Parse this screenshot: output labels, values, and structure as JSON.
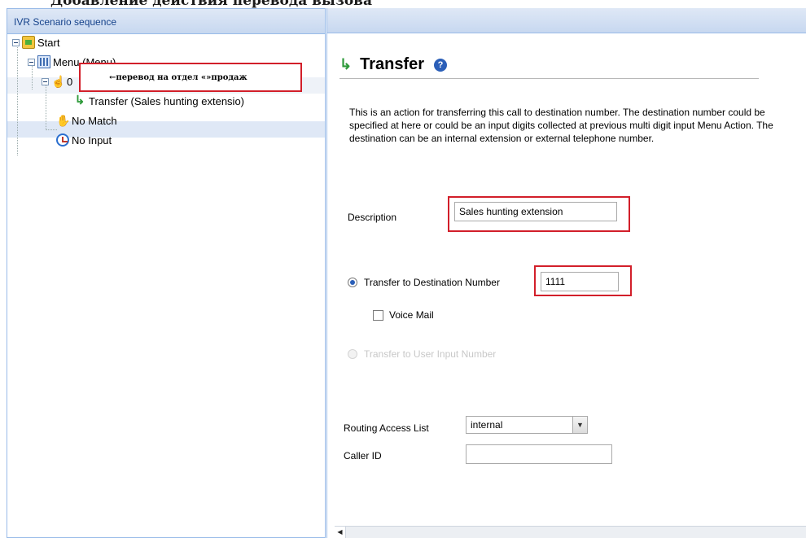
{
  "page_heading": "Добавление действия перевода вызова",
  "left_panel": {
    "title": "IVR Scenario sequence",
    "tree": {
      "start": "Start",
      "menu": "Menu (Menu)",
      "key": "0",
      "annotation": "←перевод на отдел «»продаж",
      "transfer": "Transfer (Sales hunting extensio)",
      "no_match": "No Match",
      "no_input": "No Input"
    }
  },
  "detail": {
    "title": "Transfer",
    "description": "This is an action for transferring this call to destination number. The destination number could be specified at here or could be an input digits collected at previous multi digit input Menu Action. The destination can be an internal extension or external telephone number.",
    "description_label": "Description",
    "description_value": "Sales hunting extension",
    "transfer_dest_label": "Transfer to Destination Number",
    "transfer_dest_value": "1111",
    "voice_mail_label": "Voice Mail",
    "transfer_user_label": "Transfer to User Input Number",
    "routing_label": "Routing Access List",
    "routing_value": "internal",
    "caller_id_label": "Caller ID",
    "caller_id_value": ""
  },
  "colors": {
    "panel_header": "#c7d8f0",
    "panel_border": "#99bbe8",
    "annotation_red": "#d21f2a",
    "selected_row": "#dfe8f6"
  }
}
